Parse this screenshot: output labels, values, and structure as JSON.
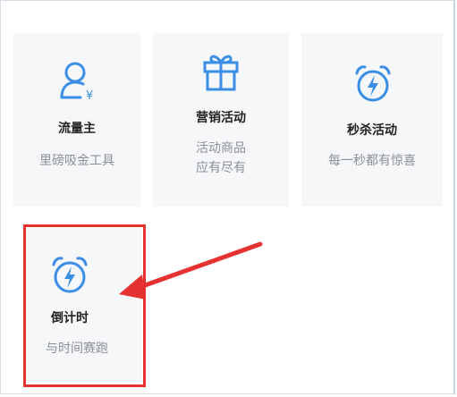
{
  "colors": {
    "accent_blue": "#3a8ee6",
    "highlight_red": "#e5312f"
  },
  "cards": [
    {
      "icon": "user-yen-icon",
      "title": "流量主",
      "desc": [
        "里磅吸金工具"
      ]
    },
    {
      "icon": "gift-icon",
      "title": "营销活动",
      "desc": [
        "活动商品",
        "应有尽有"
      ]
    },
    {
      "icon": "alarm-clock-bolt-icon",
      "title": "秒杀活动",
      "desc": [
        "每一秒都有惊喜"
      ]
    },
    {
      "icon": "alarm-clock-bolt-icon",
      "title": "倒计时",
      "desc": [
        "与时间赛跑"
      ]
    }
  ]
}
